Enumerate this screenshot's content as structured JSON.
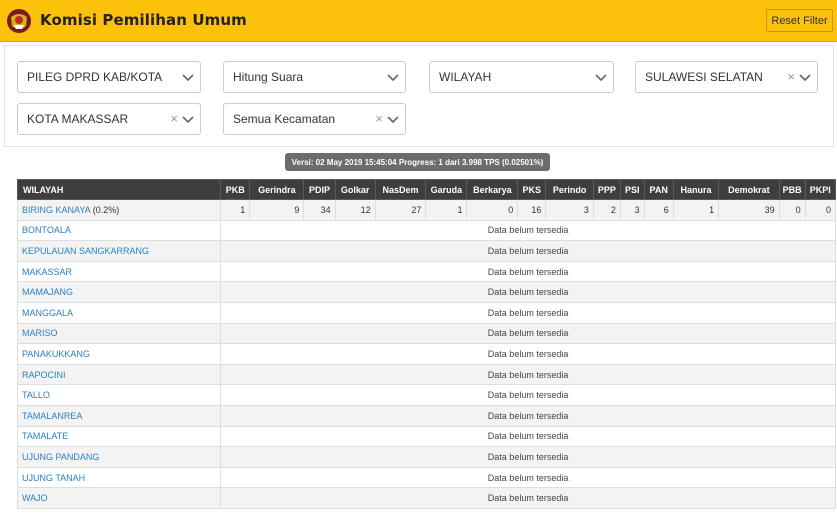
{
  "header": {
    "title": "Komisi Pemilihan Umum",
    "reset_label": "Reset Filter",
    "accent_color": "#fcc10b"
  },
  "filters": [
    {
      "value": "PILEG DPRD KAB/KOTA",
      "clearable": false
    },
    {
      "value": "Hitung Suara",
      "clearable": false
    },
    {
      "value": "WILAYAH",
      "clearable": false
    },
    {
      "value": "SULAWESI SELATAN",
      "clearable": true
    },
    {
      "value": "KOTA MAKASSAR",
      "clearable": true
    },
    {
      "value": "Semua Kecamatan",
      "clearable": true
    }
  ],
  "version": "Versi: 02 May 2019 15:45:04 Progress: 1 dari 3.998 TPS (0.02501%)",
  "table": {
    "columns": [
      "WILAYAH",
      "PKB",
      "Gerindra",
      "PDIP",
      "Golkar",
      "NasDem",
      "Garuda",
      "Berkarya",
      "PKS",
      "Perindo",
      "PPP",
      "PSI",
      "PAN",
      "Hanura",
      "Demokrat",
      "PBB",
      "PKPI"
    ],
    "no_data_label": "Data belum tersedia",
    "rows": [
      {
        "region": "BIRING KANAYA",
        "pct": "(0.2%)",
        "values": [
          "1",
          "9",
          "34",
          "12",
          "27",
          "1",
          "0",
          "16",
          "3",
          "2",
          "3",
          "6",
          "1",
          "39",
          "0",
          "0"
        ]
      },
      {
        "region": "BONTOALA"
      },
      {
        "region": "KEPULAUAN SANGKARRANG"
      },
      {
        "region": "MAKASSAR"
      },
      {
        "region": "MAMAJANG"
      },
      {
        "region": "MANGGALA"
      },
      {
        "region": "MARISO"
      },
      {
        "region": "PANAKUKKANG"
      },
      {
        "region": "RAPOCINI"
      },
      {
        "region": "TALLO"
      },
      {
        "region": "TAMALANREA"
      },
      {
        "region": "TAMALATE"
      },
      {
        "region": "UJUNG PANDANG"
      },
      {
        "region": "UJUNG TANAH"
      },
      {
        "region": "WAJO"
      }
    ]
  }
}
